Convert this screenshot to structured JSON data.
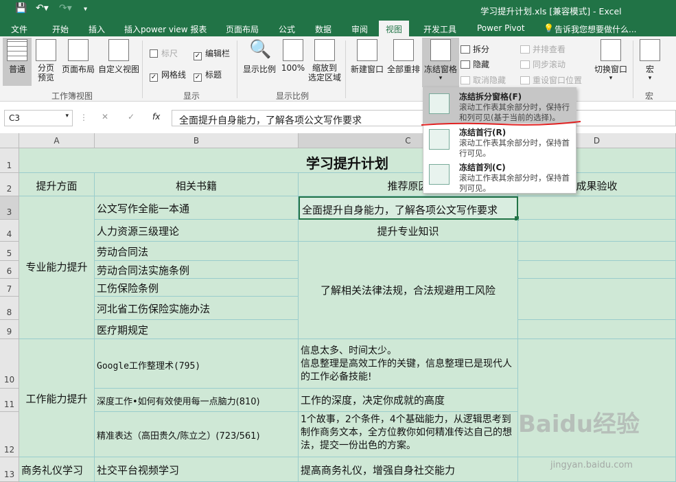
{
  "title_bar": {
    "title": "学习提升计划.xls [兼容模式] - Excel"
  },
  "tabs": [
    "文件",
    "开始",
    "插入",
    "插入power view 报表",
    "页面布局",
    "公式",
    "数据",
    "审阅",
    "视图",
    "开发工具",
    "Power Pivot"
  ],
  "tell_me": "告诉我您想要做什么...",
  "ribbon": {
    "workbook_views": {
      "group": "工作簿视图",
      "normal": "普通",
      "page_break": "分页\n预览",
      "page_layout": "页面布局",
      "custom": "自定义视图"
    },
    "show": {
      "group": "显示",
      "ruler": "标尺",
      "formula_bar": "编辑栏",
      "gridlines": "网格线",
      "headings": "标题"
    },
    "zoom": {
      "group": "显示比例",
      "zoom": "显示比例",
      "hundred": "100%",
      "selection": "缩放到\n选定区域"
    },
    "window": {
      "new_window": "新建窗口",
      "arrange_all": "全部重排",
      "freeze": "冻结窗格",
      "split": "拆分",
      "hide": "隐藏",
      "unhide": "取消隐藏",
      "side_by_side": "并排查看",
      "sync_scroll": "同步滚动",
      "reset_position": "重设窗口位置",
      "switch": "切换窗口"
    },
    "macros": {
      "macro": "宏",
      "group": "宏"
    }
  },
  "formula_bar": {
    "name_box": "C3",
    "formula": "全面提升自身能力，了解各项公文写作要求"
  },
  "freeze_menu": [
    {
      "title": "冻结拆分窗格(F)",
      "desc": "滚动工作表其余部分时，保持行和列可见(基于当前的选择)。"
    },
    {
      "title": "冻结首行(R)",
      "desc": "滚动工作表其余部分时，保持首行可见。"
    },
    {
      "title": "冻结首列(C)",
      "desc": "滚动工作表其余部分时，保持首列可见。"
    }
  ],
  "sheet": {
    "columns": [
      "A",
      "B",
      "C",
      "D"
    ],
    "rows": [
      "1",
      "2",
      "3",
      "4",
      "5",
      "6",
      "7",
      "8",
      "9",
      "10",
      "11",
      "12",
      "13"
    ],
    "title": "学习提升计划",
    "headers": [
      "提升方面",
      "相关书籍",
      "推荐原因",
      "成果验收"
    ],
    "cells": {
      "A3": "专业能力提升",
      "A10": "工作能力提升",
      "A13": "商务礼仪学习",
      "B3": "公文写作全能一本通",
      "B4": "人力资源三级理论",
      "B5": "劳动合同法",
      "B6": "劳动合同法实施条例",
      "B7": "工伤保险条例",
      "B8": "河北省工伤保险实施办法",
      "B9": "医疗期规定",
      "B10": "Google工作整理术(795)",
      "B11": "深度工作•如何有效使用每一点脑力(810)",
      "B12": "精准表达（高田贵久/陈立之）(723/561)",
      "B13": "社交平台视频学习",
      "C3": "全面提升自身能力，了解各项公文写作要求",
      "C4": "提升专业知识",
      "C5": "了解相关法律法规，合法规避用工风险",
      "C10": "信息太多、时间太少。\n信息整理是高效工作的关键，信息整理已是现代人的工作必备技能!",
      "C11": "工作的深度，决定你成就的高度",
      "C12": "1个故事，2个条件，4个基础能力，从逻辑思考到制作商务文本，全方位教你如何精准传达自己的想法，提交一份出色的方案。",
      "C13": "提高商务礼仪，增强自身社交能力"
    }
  },
  "watermark": {
    "text": "Baidu经验",
    "url": "jingyan.baidu.com"
  },
  "colors": {
    "excel_green": "#217346",
    "cell_fill": "#cfe8d6",
    "annotation": "#e02020"
  }
}
